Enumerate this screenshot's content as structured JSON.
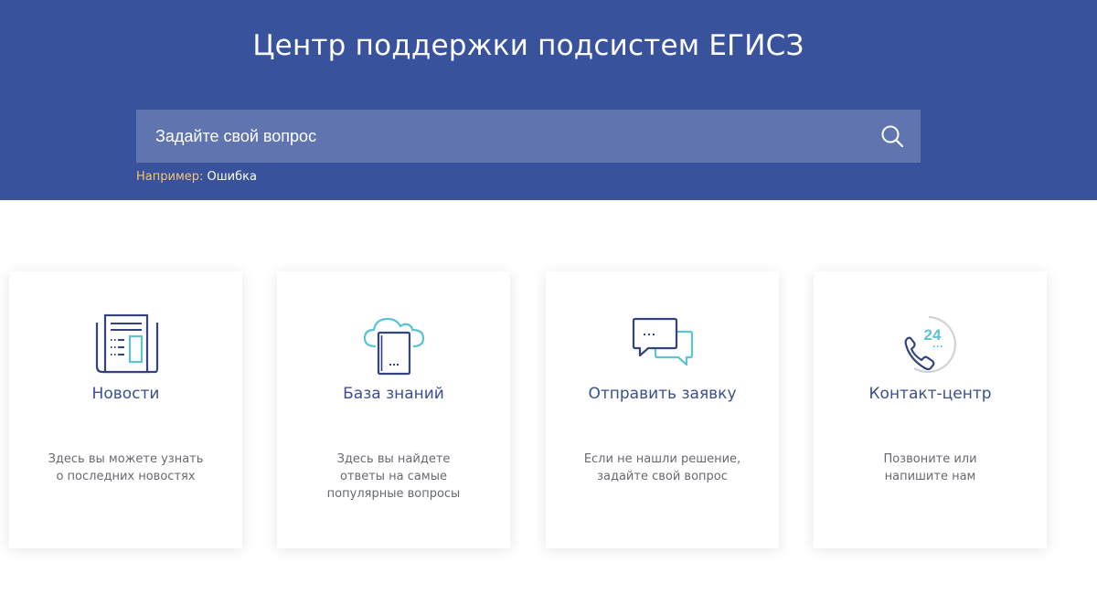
{
  "header": {
    "title": "Центр поддержки подсистем ЕГИСЗ"
  },
  "search": {
    "placeholder": "Задайте свой вопрос",
    "icon": "search-icon",
    "example_label": "Например:",
    "example_value": "Ошибка"
  },
  "colors": {
    "hero_bg": "#39529c",
    "search_bg": "#6075b0",
    "accent_yellow": "#f5c27a",
    "card_title": "#3a4f8f",
    "icon_navy": "#33437e",
    "icon_teal": "#5cc3d4"
  },
  "cards": [
    {
      "title": "Новости",
      "desc1": "Здесь вы можете узнать",
      "desc2": "о последних новостях",
      "desc3": "",
      "icon": "newspaper-icon"
    },
    {
      "title": "База знаний",
      "desc1": "Здесь вы найдете",
      "desc2": "ответы на самые",
      "desc3": "популярные вопросы",
      "icon": "cloud-book-icon"
    },
    {
      "title": "Отправить заявку",
      "desc1": "Если не нашли решение,",
      "desc2": "задайте свой вопрос",
      "desc3": "",
      "icon": "chat-bubbles-icon"
    },
    {
      "title": "Контакт-центр",
      "desc1": "Позвоните или",
      "desc2": "напишите нам",
      "desc3": "",
      "icon": "phone-24-icon"
    }
  ],
  "phone_icon_text": "24"
}
